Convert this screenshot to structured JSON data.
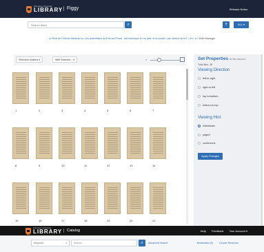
{
  "header": {
    "university": "Princeton University",
    "library": "LIBRARY",
    "app_name": "Figgy",
    "release_notes": "Release Notes"
  },
  "search": {
    "placeholder": "Search items",
    "search_icon": "search-icon",
    "plus_label": "+",
    "scope_label": "ALL ▾"
  },
  "breadcrumb": {
    "item": "Le Réel de Colonel Maubuis ou, Les anarchistes au Port-au-Prince : fait historique en un acte, et en prose / par l'auteur de la F., et c. a",
    "current": "Order Manager"
  },
  "toolbar": {
    "selection_options": "Selection Options ▾",
    "with_selected": "With Selected... ▾",
    "zoom_label": "0"
  },
  "thumbnails": [
    {
      "label": "1"
    },
    {
      "label": "2"
    },
    {
      "label": "3"
    },
    {
      "label": "4"
    },
    {
      "label": "5"
    },
    {
      "label": "6"
    },
    {
      "label": "7"
    },
    {
      "label": "8"
    },
    {
      "label": "9"
    },
    {
      "label": "10"
    },
    {
      "label": "11"
    },
    {
      "label": "12"
    },
    {
      "label": "13"
    },
    {
      "label": "14"
    },
    {
      "label": "15"
    },
    {
      "label": "16"
    },
    {
      "label": "17"
    },
    {
      "label": "18"
    },
    {
      "label": "19"
    },
    {
      "label": "20"
    },
    {
      "label": "21"
    }
  ],
  "properties": {
    "title": "Set Properties",
    "title_note": "for this resource",
    "total_files": "Total files: 38",
    "viewing_direction": {
      "heading": "Viewing Direction",
      "options": [
        {
          "label": "left-to-right",
          "selected": false
        },
        {
          "label": "right-to-left",
          "selected": false
        },
        {
          "label": "top-to-bottom",
          "selected": false
        },
        {
          "label": "bottom-to-top",
          "selected": false
        }
      ]
    },
    "viewing_hint": {
      "heading": "Viewing Hint",
      "options": [
        {
          "label": "individuals",
          "selected": true
        },
        {
          "label": "paged",
          "selected": false
        },
        {
          "label": "continuous",
          "selected": false
        }
      ]
    },
    "apply_label": "Apply Changes"
  },
  "catalog": {
    "university": "Princeton University",
    "library": "LIBRARY",
    "name": "Catalog",
    "links": [
      "Help",
      "Feedback",
      "Your Account ▾"
    ],
    "field_select": "Keyword",
    "search_placeholder": "Search...",
    "advanced": "Advanced Search",
    "bookmarks": "Bookmarks (0)",
    "course_reserves": "Course Reserves"
  }
}
